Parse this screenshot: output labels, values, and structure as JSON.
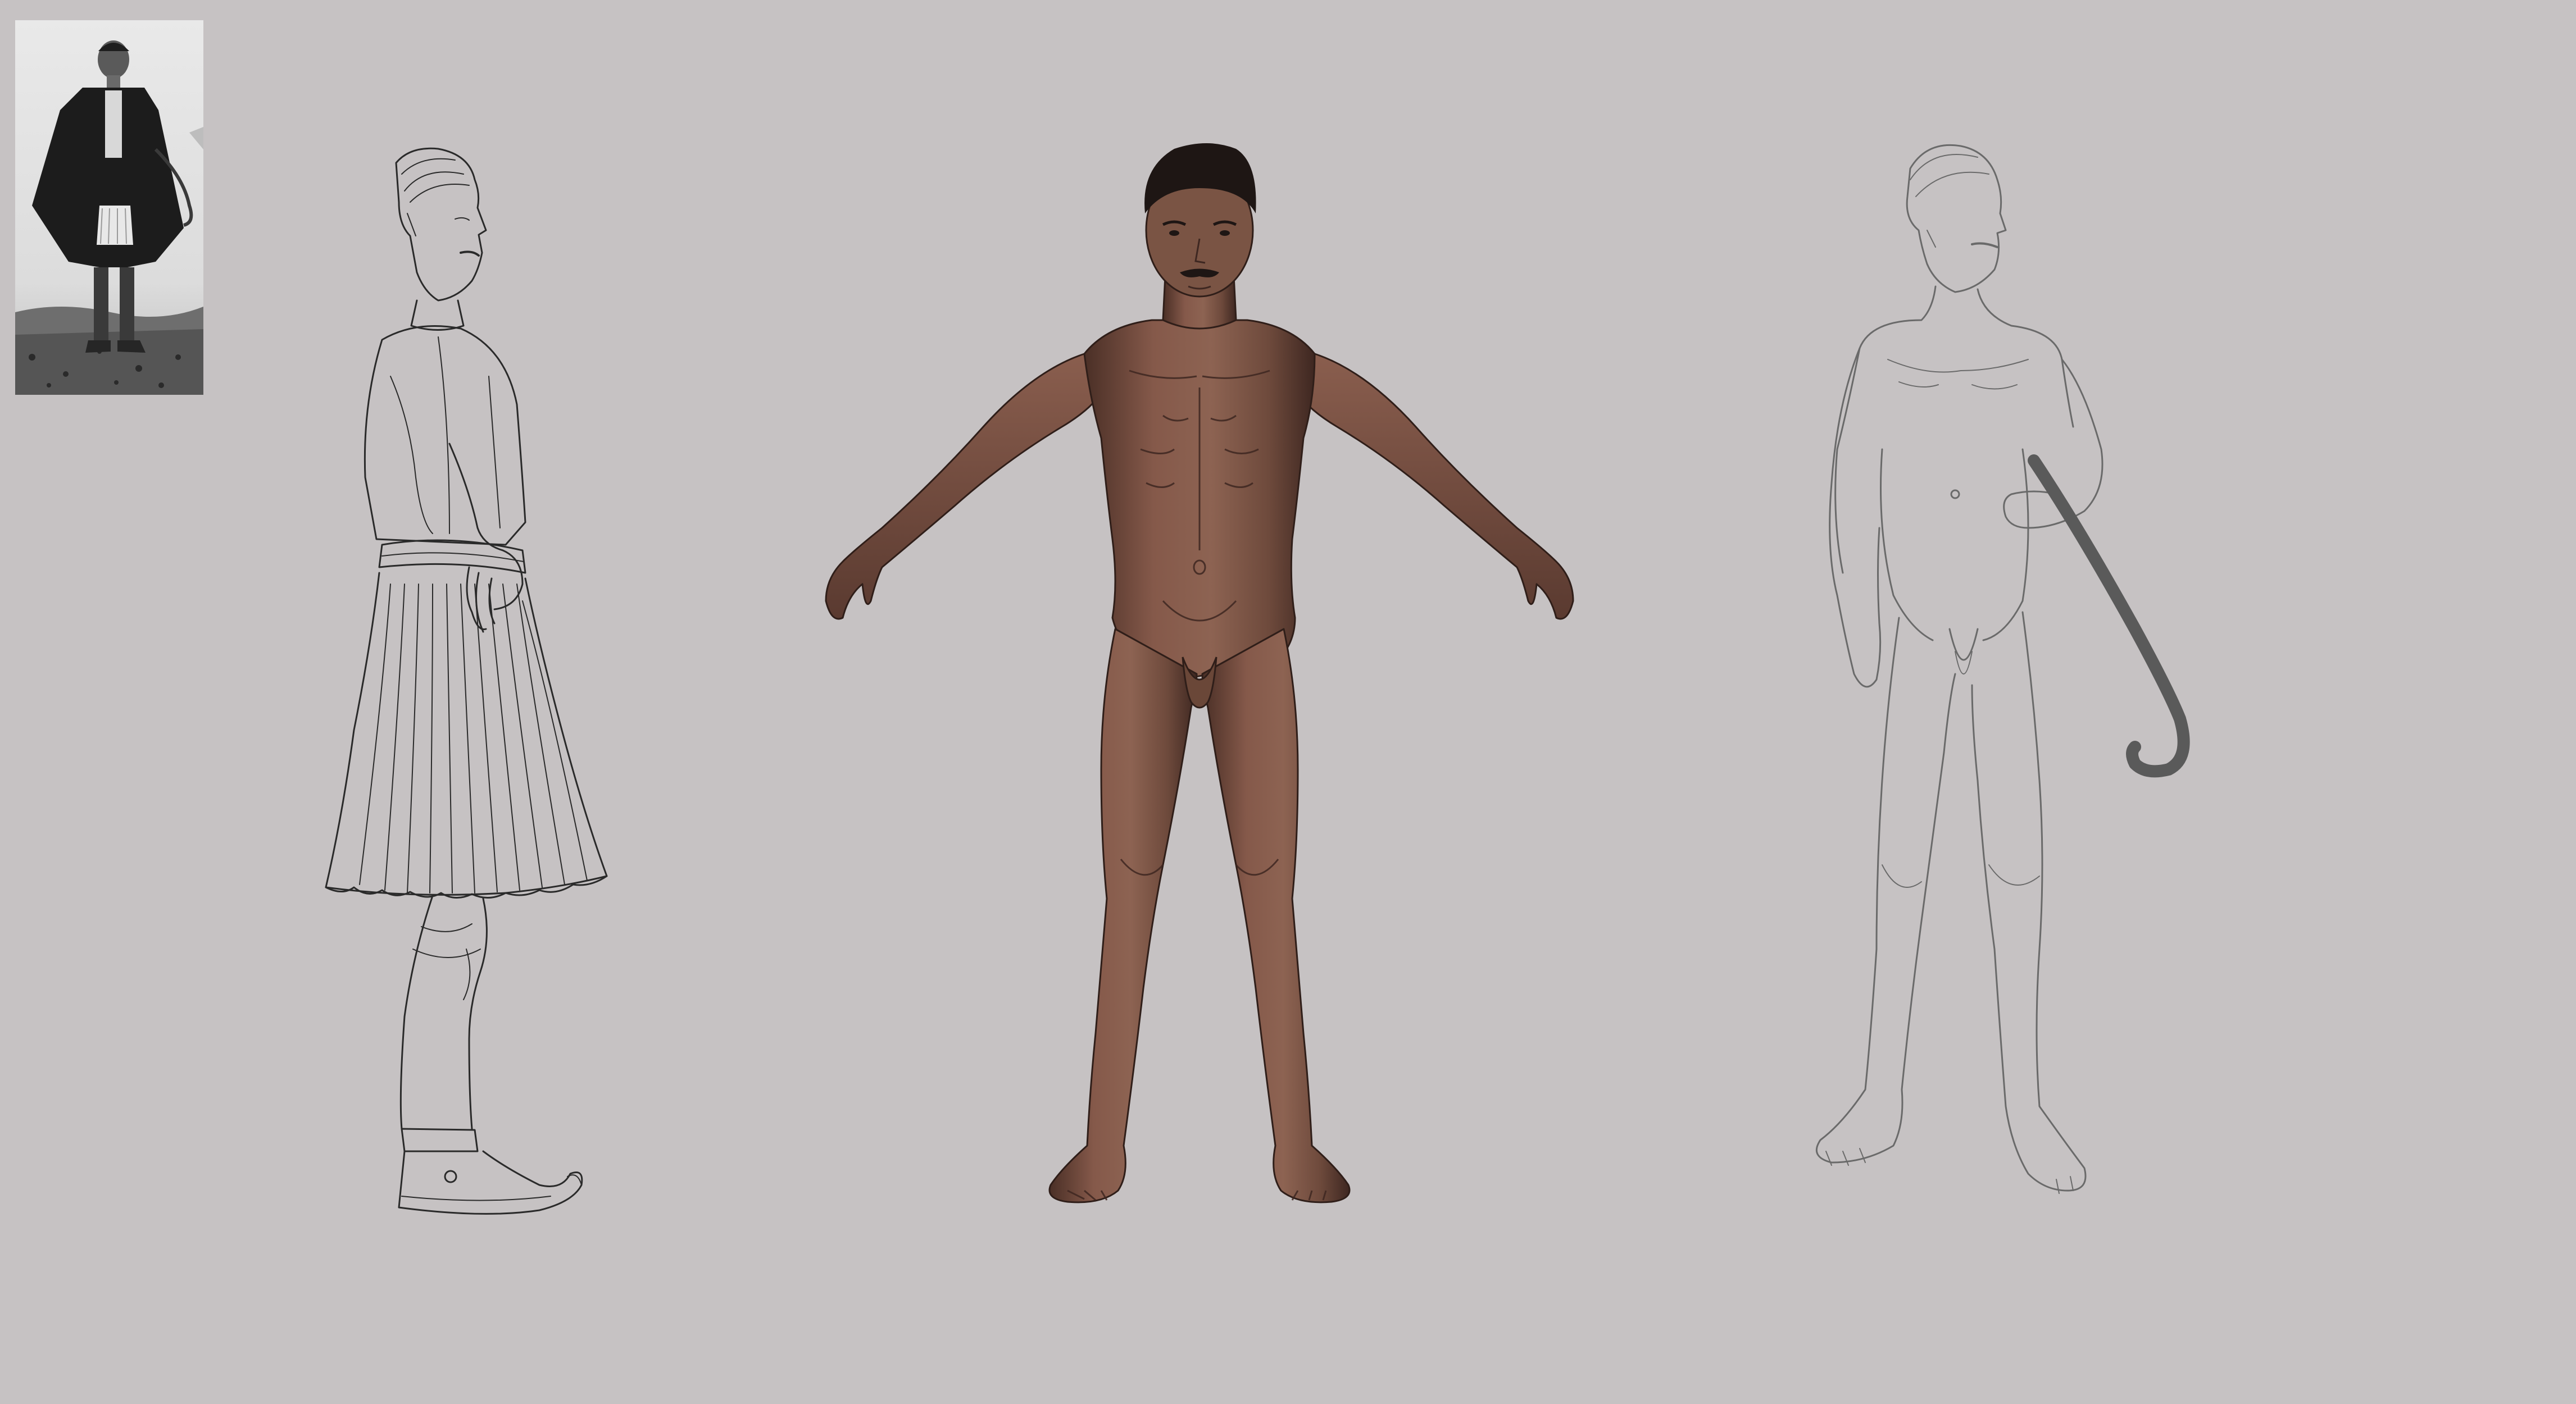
{
  "canvas": {
    "background_color": "#c6c2c3"
  },
  "artwork": {
    "reference_photo": {
      "tone": "grayscale"
    },
    "side_sketch": {
      "medium": "line-art",
      "stroke_color": "#2a2a2a"
    },
    "front_figure": {
      "medium": "painted",
      "skin_color": "#7a5444",
      "shadow_color": "#3e2721",
      "hair_color": "#1e1614"
    },
    "three_quarter_sketch": {
      "medium": "line-art",
      "stroke_color": "#6a6a6a",
      "staff_color": "#5a5a5a"
    }
  }
}
